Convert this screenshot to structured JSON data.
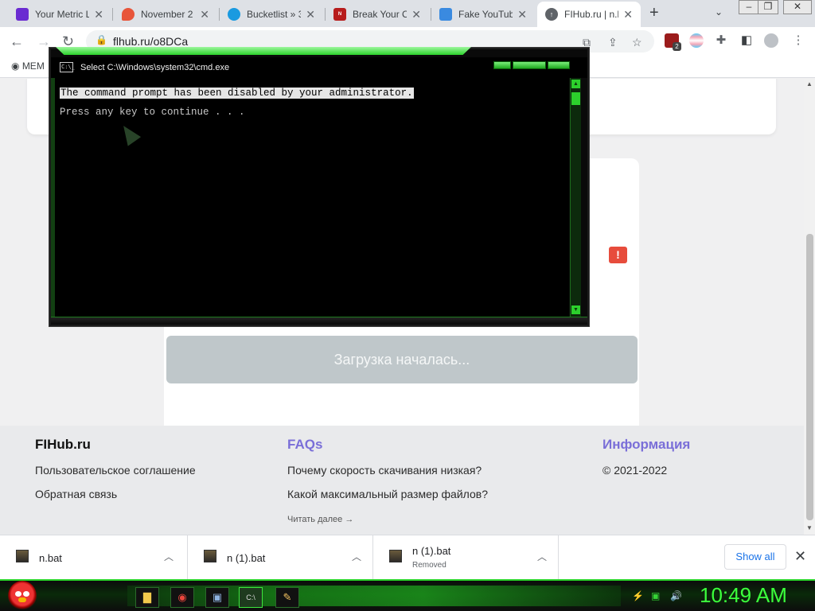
{
  "browser": {
    "tabs": [
      {
        "title": "Your Metric L",
        "favicon_color": "#6a2bd1",
        "active": false
      },
      {
        "title": "November 2",
        "favicon_color": "#e8553a",
        "active": false
      },
      {
        "title": "Bucketlist » 3",
        "favicon_color": "#1a9ae0",
        "active": false
      },
      {
        "title": "Break Your C",
        "favicon_color": "#b71c1c",
        "active": false
      },
      {
        "title": "Fake YouTub",
        "favicon_color": "#3a8ae0",
        "active": false
      },
      {
        "title": "FIHub.ru | n.b",
        "favicon_color": "#5f6368",
        "active": true
      }
    ],
    "new_tab": "+",
    "url": "flhub.ru/o8DCa",
    "bookmark_label": "MEM",
    "extension_badge": "2"
  },
  "page": {
    "download_button": "Загрузка началась...",
    "footer": {
      "col1": {
        "heading": "FIHub.ru",
        "links": [
          "Пользовательское соглашение",
          "Обратная связь"
        ]
      },
      "col2": {
        "heading": "FAQs",
        "links": [
          "Почему скорость скачивания низкая?",
          "Какой максимальный размер файлов?"
        ],
        "more": "Читать далее →"
      },
      "col3": {
        "heading": "Информация",
        "links": [
          "© 2021-2022"
        ]
      },
      "heading_color": "#7a6fd8"
    }
  },
  "cmd": {
    "title": "Select C:\\Windows\\system32\\cmd.exe",
    "icon_text": "C:\\_",
    "line1": "The command prompt has been disabled by your administrator.",
    "line2": "Press any key to continue . . ."
  },
  "downloads": {
    "items": [
      {
        "name": "n.bat",
        "status": ""
      },
      {
        "name": "n (1).bat",
        "status": ""
      },
      {
        "name": "n (1).bat",
        "status": "Removed"
      }
    ],
    "show_all": "Show all"
  },
  "taskbar": {
    "clock": "10:49 AM"
  }
}
